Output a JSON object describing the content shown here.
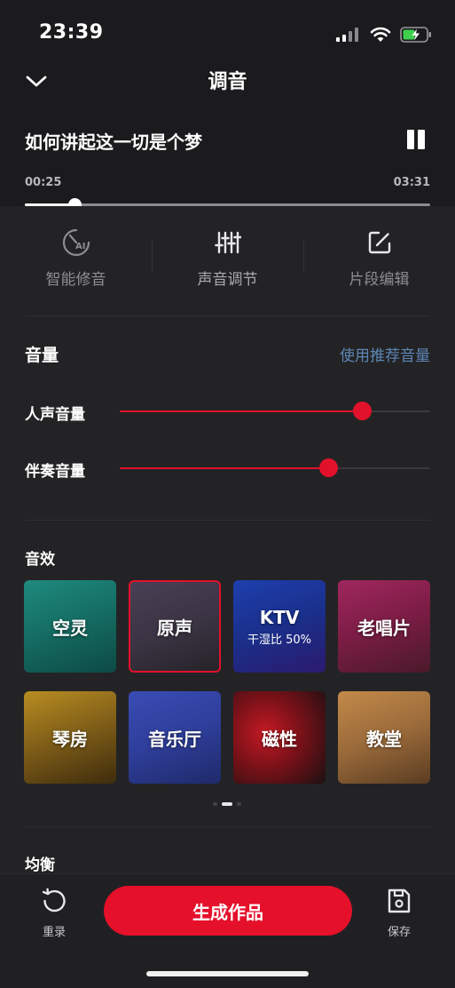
{
  "status": {
    "time": "23:39"
  },
  "header": {
    "title": "调音"
  },
  "player": {
    "song_title": "如何讲起这一切是个梦",
    "current_time": "00:25",
    "total_time": "03:31",
    "progress": 0.122
  },
  "tools": [
    {
      "label": "智能修音",
      "icon": "ai-tune-icon"
    },
    {
      "label": "声音调节",
      "icon": "equalizer-sliders-icon"
    },
    {
      "label": "片段编辑",
      "icon": "edit-icon"
    }
  ],
  "volume": {
    "title": "音量",
    "recommend_link": "使用推荐音量",
    "vocal": {
      "label": "人声音量",
      "value": 0.78
    },
    "accompaniment": {
      "label": "伴奏音量",
      "value": 0.67
    }
  },
  "effects": {
    "title": "音效",
    "items": [
      {
        "name": "空灵",
        "sub": "",
        "selected": false
      },
      {
        "name": "原声",
        "sub": "",
        "selected": true
      },
      {
        "name": "KTV",
        "sub": "干湿比 50%",
        "selected": false
      },
      {
        "name": "老唱片",
        "sub": "",
        "selected": false
      },
      {
        "name": "琴房",
        "sub": "",
        "selected": false
      },
      {
        "name": "音乐厅",
        "sub": "",
        "selected": false
      },
      {
        "name": "磁性",
        "sub": "",
        "selected": false
      },
      {
        "name": "教堂",
        "sub": "",
        "selected": false
      }
    ],
    "page": 2,
    "page_count": 3
  },
  "equalizer": {
    "title": "均衡"
  },
  "bottom": {
    "reset_label": "重录",
    "generate_label": "生成作品",
    "save_label": "保存"
  },
  "colors": {
    "accent": "#e2112b",
    "link": "#5d86b5",
    "background": "#1b1b1d",
    "panel": "#232325"
  }
}
